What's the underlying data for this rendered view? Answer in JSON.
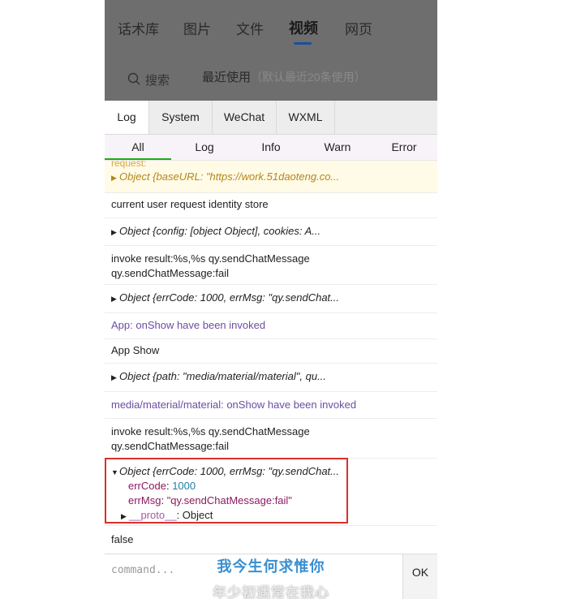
{
  "app_tabs": [
    "话术库",
    "图片",
    "文件",
    "视频",
    "网页"
  ],
  "app_active_tab": "视频",
  "search": {
    "label": "搜索"
  },
  "recent": {
    "label": "最近使用",
    "hint": "（默认最近20条使用）"
  },
  "vconsole_tabs": [
    "Log",
    "System",
    "WeChat",
    "WXML"
  ],
  "log_filters": [
    "All",
    "Log",
    "Info",
    "Warn",
    "Error"
  ],
  "logs": {
    "r0_label": "request:",
    "r0_obj": "Object {baseURL: \"https://work.51daoteng.co...",
    "r1": "current user request identity store",
    "r2_obj": "Object {config: [object Object], cookies: A...",
    "r3_l1": "invoke result:%s,%s qy.sendChatMessage",
    "r3_l2": "qy.sendChatMessage:fail",
    "r4_obj": "Object {errCode: 1000, errMsg: \"qy.sendChat...",
    "r5": "App: onShow have been invoked",
    "r6": "App Show",
    "r7_obj": "Object {path: \"media/material/material\", qu...",
    "r8": "media/material/material: onShow have been invoked",
    "r9_l1": "invoke result:%s,%s qy.sendChatMessage",
    "r9_l2": "qy.sendChatMessage:fail",
    "r10_obj": "Object {errCode: 1000, errMsg: \"qy.sendChat...",
    "r10_errCode_key": "errCode",
    "r10_errCode_val": "1000",
    "r10_errMsg_key": "errMsg",
    "r10_errMsg_val": "\"qy.sendChatMessage:fail\"",
    "r10_proto_key": "__proto__",
    "r10_proto_val": "Object",
    "r11": "false"
  },
  "command": {
    "placeholder": "command...",
    "ok_label": "OK"
  },
  "subtitles": {
    "line1": "我今生何求惟你",
    "line2": "年少初遇常在我心"
  }
}
